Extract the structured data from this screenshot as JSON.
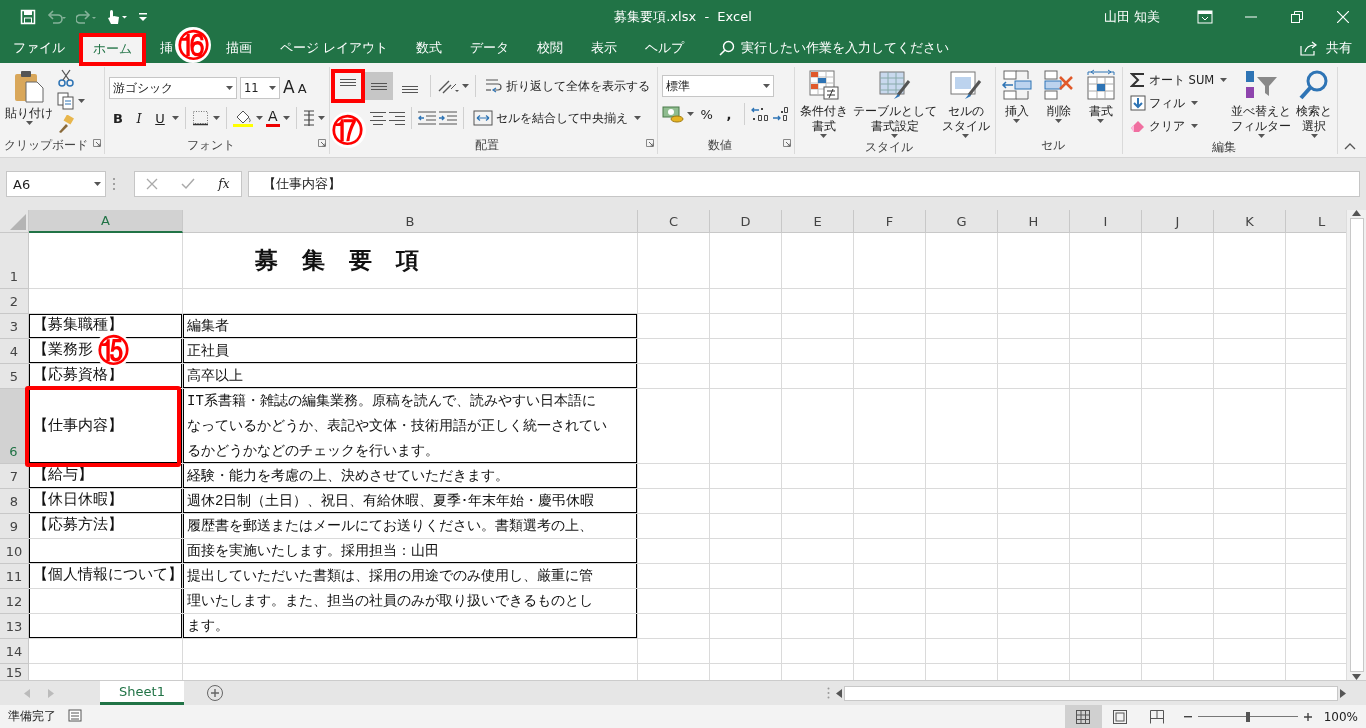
{
  "title_bar": {
    "quick_access": [
      {
        "kind": "save",
        "disabled": false
      },
      {
        "kind": "undo",
        "disabled": true
      },
      {
        "kind": "redo",
        "disabled": true
      },
      {
        "kind": "touch",
        "disabled": false
      },
      {
        "kind": "customize",
        "disabled": false
      }
    ],
    "title": "募集要項.xlsx  -  Excel",
    "user": "山田 知美",
    "controls": [
      {
        "kind": "ribbon-options"
      },
      {
        "kind": "minimize"
      },
      {
        "kind": "restore"
      },
      {
        "kind": "close"
      }
    ]
  },
  "tabs": [
    {
      "label": "ファイル",
      "selected": false,
      "highlighted": false
    },
    {
      "label": "ホーム",
      "selected": true,
      "highlighted": true
    },
    {
      "label": "挿",
      "selected": false,
      "highlighted": false,
      "callout": "⑯"
    },
    {
      "label": "描画",
      "selected": false,
      "highlighted": false
    },
    {
      "label": "ページ レイアウト",
      "selected": false,
      "highlighted": false
    },
    {
      "label": "数式",
      "selected": false,
      "highlighted": false
    },
    {
      "label": "データ",
      "selected": false,
      "highlighted": false
    },
    {
      "label": "校閲",
      "selected": false,
      "highlighted": false
    },
    {
      "label": "表示",
      "selected": false,
      "highlighted": false
    },
    {
      "label": "ヘルプ",
      "selected": false,
      "highlighted": false
    }
  ],
  "tell_me": {
    "placeholder": "実行したい作業を入力してください"
  },
  "share": "共有",
  "ribbon": {
    "clipboard": {
      "label": "クリップボード",
      "paste": "貼り付け"
    },
    "font": {
      "label": "フォント",
      "font_name": "游ゴシック",
      "font_size": "11",
      "grow": "A",
      "shrink": "A",
      "bold": "B",
      "italic": "I",
      "underline": "U",
      "font_color": "A"
    },
    "alignment": {
      "label": "配置",
      "vertical": [
        {
          "kind": "top",
          "selected": false,
          "highlighted": true,
          "callout": "⑰"
        },
        {
          "kind": "middle",
          "selected": true,
          "highlighted": false
        },
        {
          "kind": "bottom",
          "selected": false,
          "highlighted": false
        }
      ],
      "wrap": "折り返して全体を表示する",
      "merge": "セルを結合して中央揃え"
    },
    "number": {
      "label": "数値",
      "format": "標準",
      "percent": "%",
      "comma": ","
    },
    "styles": {
      "label": "スタイル",
      "buttons": [
        {
          "kind": "conditional",
          "lines": [
            "条件付き",
            "書式"
          ]
        },
        {
          "kind": "table",
          "lines": [
            "テーブルとして",
            "書式設定"
          ]
        },
        {
          "kind": "cell-style",
          "lines": [
            "セルの",
            "スタイル"
          ]
        }
      ]
    },
    "cells": {
      "label": "セル",
      "buttons": [
        {
          "kind": "insert",
          "lines": [
            "挿入"
          ]
        },
        {
          "kind": "delete",
          "lines": [
            "削除"
          ]
        },
        {
          "kind": "format",
          "lines": [
            "書式"
          ]
        }
      ]
    },
    "editing": {
      "label": "編集",
      "small": [
        {
          "kind": "sum",
          "label": "オート SUM"
        },
        {
          "kind": "fill",
          "label": "フィル"
        },
        {
          "kind": "clear",
          "label": "クリア"
        }
      ],
      "large": [
        {
          "kind": "sort",
          "lines": [
            "並べ替えと",
            "フィルター"
          ]
        },
        {
          "kind": "find",
          "lines": [
            "検索と",
            "選択"
          ]
        }
      ]
    }
  },
  "formula_bar": {
    "name_box": "A6",
    "function_label": "fx",
    "value": "【仕事内容】"
  },
  "sheet": {
    "columns": [
      {
        "label": "A",
        "selected": true
      },
      {
        "label": "B",
        "selected": false
      },
      {
        "label": "C",
        "selected": false
      },
      {
        "label": "D",
        "selected": false
      },
      {
        "label": "E",
        "selected": false
      },
      {
        "label": "F",
        "selected": false
      },
      {
        "label": "G",
        "selected": false
      },
      {
        "label": "H",
        "selected": false
      },
      {
        "label": "I",
        "selected": false
      },
      {
        "label": "J",
        "selected": false
      },
      {
        "label": "K",
        "selected": false
      },
      {
        "label": "L",
        "selected": false
      }
    ],
    "rows": [
      {
        "number": "1",
        "selected": false,
        "cells": [
          {},
          {
            "kind": "title",
            "text": "募 集 要 項"
          }
        ]
      },
      {
        "number": "2",
        "selected": false,
        "cells": []
      },
      {
        "number": "3",
        "selected": false,
        "cells": [
          {
            "text": "【募集職種】",
            "outlined": true,
            "line_top": true,
            "line_bottom": true
          },
          {
            "text": "編集者",
            "outlined": true,
            "line_top": true,
            "line_bottom": true
          }
        ]
      },
      {
        "number": "4",
        "selected": false,
        "cells": [
          {
            "text": "【業務形",
            "outlined": true,
            "line_bottom": true,
            "callout": "⑮"
          },
          {
            "text": "正社員",
            "outlined": true,
            "line_bottom": true
          }
        ]
      },
      {
        "number": "5",
        "selected": false,
        "cells": [
          {
            "text": "【応募資格】",
            "outlined": true,
            "line_bottom": true
          },
          {
            "text": "高卒以上",
            "outlined": true,
            "line_bottom": true
          }
        ]
      },
      {
        "number": "6",
        "selected": true,
        "cells": [
          {
            "text": "【仕事内容】",
            "outlined": true,
            "line_bottom": true,
            "middle": true,
            "highlighted": true
          },
          {
            "text": "IT系書籍・雑誌の編集業務。原稿を読んで、読みやすい日本語になっているかどうか、表記や文体・技術用語が正しく統一されているかどうかなどのチェックを行います。",
            "outlined": true,
            "line_bottom": true
          }
        ]
      },
      {
        "number": "7",
        "selected": false,
        "cells": [
          {
            "text": "【給与】",
            "outlined": true,
            "line_bottom": true
          },
          {
            "text": "経験・能力を考慮の上、決めさせていただきます。",
            "outlined": true,
            "line_bottom": true
          }
        ]
      },
      {
        "number": "8",
        "selected": false,
        "cells": [
          {
            "text": "【休日休暇】",
            "outlined": true,
            "line_bottom": true
          },
          {
            "text": "週休2日制（土日）、祝日、有給休暇、夏季･年末年始・慶弔休暇",
            "outlined": true,
            "line_bottom": true
          }
        ]
      },
      {
        "number": "9",
        "selected": false,
        "cells": [
          {
            "text": "【応募方法】",
            "outlined": true,
            "line_bottom": false
          },
          {
            "text": "履歴書を郵送またはメールにてお送りください。書類選考の上、",
            "outlined": true,
            "line_bottom": false
          }
        ]
      },
      {
        "number": "10",
        "selected": false,
        "cells": [
          {
            "outlined": true,
            "line_bottom": true
          },
          {
            "text": "面接を実施いたします。採用担当：山田",
            "outlined": true,
            "line_bottom": true
          }
        ]
      },
      {
        "number": "11",
        "selected": false,
        "cells": [
          {
            "text": "【個人情報について】",
            "outlined": true,
            "line_bottom": false
          },
          {
            "text": "提出していただいた書類は、採用の用途でのみ使用し、厳重に管",
            "outlined": true,
            "line_bottom": false
          }
        ]
      },
      {
        "number": "12",
        "selected": false,
        "cells": [
          {
            "outlined": true,
            "line_bottom": false
          },
          {
            "text": "理いたします。また、担当の社員のみが取り扱いできるものとし",
            "outlined": true,
            "line_bottom": false
          }
        ]
      },
      {
        "number": "13",
        "selected": false,
        "cells": [
          {
            "outlined": true,
            "line_bottom": true
          },
          {
            "text": "ます。",
            "outlined": true,
            "line_bottom": true
          }
        ]
      },
      {
        "number": "14",
        "selected": false,
        "cells": []
      },
      {
        "number": "15",
        "selected": false,
        "cells": []
      }
    ]
  },
  "sheet_tabs": [
    {
      "label": "Sheet1",
      "selected": true
    }
  ],
  "status_bar": {
    "status": "準備完了",
    "views": [
      {
        "kind": "normal",
        "selected": true
      },
      {
        "kind": "page-layout",
        "selected": false
      },
      {
        "kind": "page-break",
        "selected": false
      }
    ],
    "zoom": {
      "level": 0.5,
      "reading": "100%"
    }
  }
}
